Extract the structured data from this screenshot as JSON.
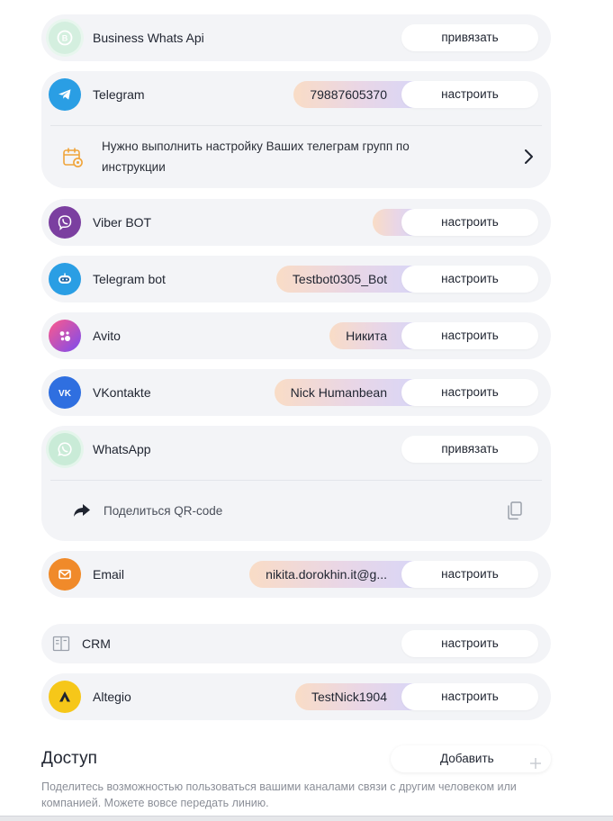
{
  "channels": {
    "business_whats_api": {
      "name": "Business Whats Api",
      "button": "привязать"
    },
    "telegram": {
      "name": "Telegram",
      "value": "79887605370",
      "button": "настроить",
      "notice": "Нужно выполнить настройку Ваших телеграм групп по инструкции"
    },
    "viber_bot": {
      "name": "Viber BOT",
      "value": "",
      "button": "настроить"
    },
    "telegram_bot": {
      "name": "Telegram bot",
      "value": "Testbot0305_Bot",
      "button": "настроить"
    },
    "avito": {
      "name": "Avito",
      "value": "Никита",
      "button": "настроить"
    },
    "vkontakte": {
      "name": "VKontakte",
      "value": "Nick Humanbean",
      "button": "настроить"
    },
    "whatsapp": {
      "name": "WhatsApp",
      "button": "привязать",
      "share": "Поделиться QR-code"
    },
    "email": {
      "name": "Email",
      "value": "nikita.dorokhin.it@g...",
      "button": "настроить"
    },
    "crm": {
      "name": "CRM",
      "button": "настроить"
    },
    "altegio": {
      "name": "Altegio",
      "value": "TestNick1904",
      "button": "настроить"
    }
  },
  "access": {
    "title": "Доступ",
    "add_button": "Добавить",
    "description": "Поделитесь возможностью пользоваться вашими каналами связи с другим человеком или компанией. Можете вовсе передать линию."
  },
  "icons": {
    "business_whats_api": "business-whatsapp-icon",
    "telegram": "telegram-icon",
    "telegram_notice": "calendar-gear-icon",
    "viber_bot": "viber-icon",
    "telegram_bot": "bot-icon",
    "avito": "avito-icon",
    "vkontakte": "vk-icon",
    "whatsapp": "whatsapp-icon",
    "share": "share-arrow-icon",
    "copy": "copy-icon",
    "email": "email-icon",
    "crm": "crm-icon",
    "altegio": "altegio-icon"
  },
  "colors": {
    "card_bg": "#f3f4f7",
    "telegram": "#2a9ee4",
    "viber": "#7b3fa0",
    "vk": "#2f6fe0",
    "email": "#f08a2a",
    "altegio": "#f6c719",
    "whatsapp_inactive": "#c9ebd7",
    "notice_accent": "#f0a43a"
  }
}
